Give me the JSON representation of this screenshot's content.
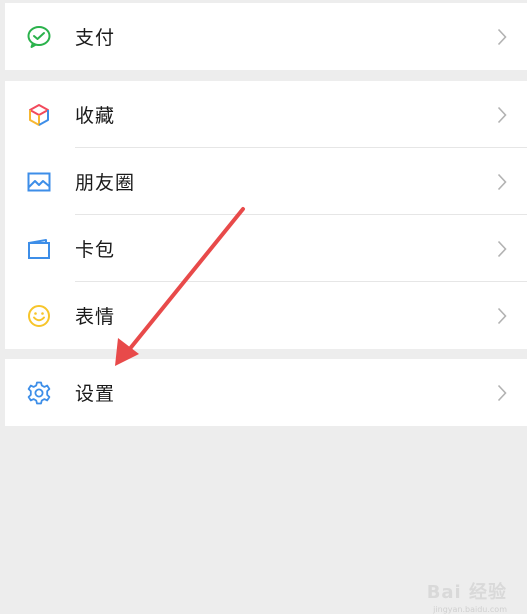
{
  "menu": {
    "group1": [
      {
        "label": "支付",
        "icon": "wechat-pay-icon"
      }
    ],
    "group2": [
      {
        "label": "收藏",
        "icon": "favorites-cube-icon"
      },
      {
        "label": "朋友圈",
        "icon": "moments-image-icon"
      },
      {
        "label": "卡包",
        "icon": "card-wallet-icon"
      },
      {
        "label": "表情",
        "icon": "sticker-smiley-icon"
      }
    ],
    "group3": [
      {
        "label": "设置",
        "icon": "settings-gear-icon"
      }
    ]
  },
  "annotation": {
    "arrow_color": "#e84a4a"
  },
  "watermark": {
    "text": "Bai 经验",
    "sub": "jingyan.baidu.com"
  },
  "colors": {
    "pay_green": "#2bb24c",
    "background": "#ededed",
    "chevron": "#b2b2b2"
  }
}
